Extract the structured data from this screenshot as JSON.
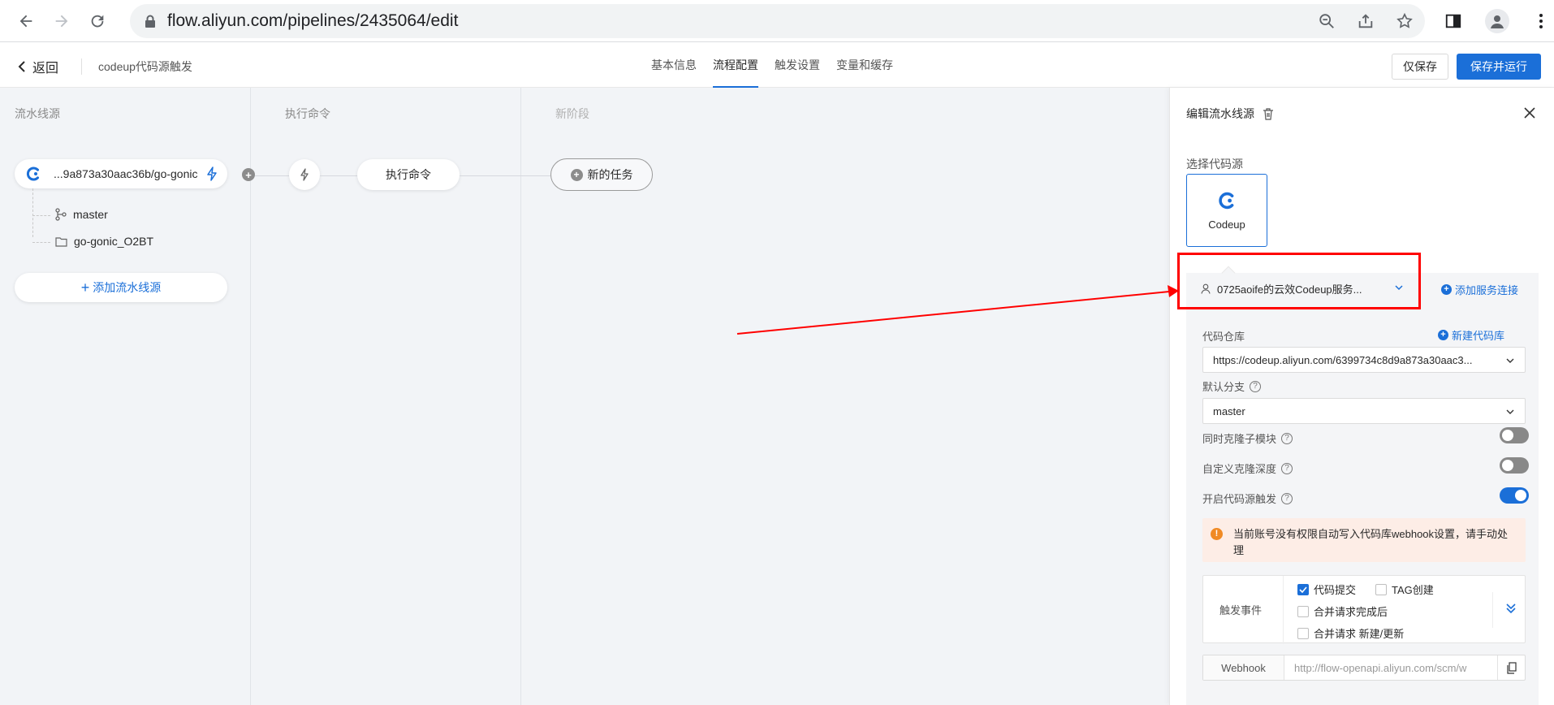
{
  "browser": {
    "url": "flow.aliyun.com/pipelines/2435064/edit"
  },
  "header": {
    "back_label": "返回",
    "pipeline_name": "codeup代码源触发",
    "tabs": [
      {
        "label": "基本信息",
        "active": false
      },
      {
        "label": "流程配置",
        "active": true
      },
      {
        "label": "触发设置",
        "active": false
      },
      {
        "label": "变量和缓存",
        "active": false
      }
    ],
    "save_label": "仅保存",
    "save_run_label": "保存并运行"
  },
  "canvas": {
    "stages": [
      {
        "title": "流水线源"
      },
      {
        "title": "执行命令"
      },
      {
        "title": "新阶段"
      }
    ],
    "source": {
      "repo": "...9a873a30aac36b/go-gonic",
      "branch": "master",
      "folder": "go-gonic_O2BT"
    },
    "add_source_label": "添加流水线源",
    "job_label": "执行命令",
    "new_task_label": "新的任务"
  },
  "panel": {
    "title": "编辑流水线源",
    "choose_source_label": "选择代码源",
    "codeup_label": "Codeup",
    "service_connection": "0725aoife的云效Codeup服务...",
    "add_connection_label": "添加服务连接",
    "repo_label": "代码仓库",
    "new_repo_label": "新建代码库",
    "repo_value": "https://codeup.aliyun.com/6399734c8d9a873a30aac3...",
    "branch_label": "默认分支",
    "branch_value": "master",
    "submodule_label": "同时克隆子模块",
    "submodule_on": false,
    "depth_label": "自定义克隆深度",
    "depth_on": false,
    "trigger_label": "开启代码源触发",
    "trigger_on": true,
    "warning_text": "当前账号没有权限自动写入代码库webhook设置，请手动处理",
    "events_label": "触发事件",
    "events": [
      {
        "label": "代码提交",
        "checked": true
      },
      {
        "label": "TAG创建",
        "checked": false
      },
      {
        "label": "合并请求完成后",
        "checked": false
      },
      {
        "label": "合并请求 新建/更新",
        "checked": false
      }
    ],
    "webhook_label": "Webhook",
    "webhook_value": "http://flow-openapi.aliyun.com/scm/w"
  },
  "colors": {
    "accent": "#1b6fd8",
    "annotation": "#ff0000",
    "warning": "#f08a24"
  }
}
